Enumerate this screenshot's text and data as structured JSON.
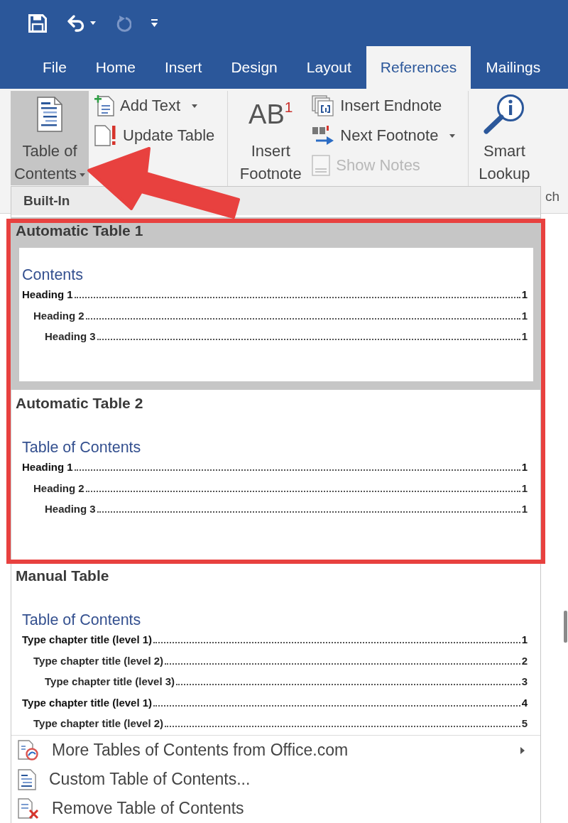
{
  "quick_access": [
    {
      "kind": "save",
      "disabled": false,
      "dropdown": false
    },
    {
      "kind": "undo",
      "disabled": false,
      "dropdown": true
    },
    {
      "kind": "redo",
      "disabled": true,
      "dropdown": false
    },
    {
      "kind": "customize",
      "disabled": false,
      "dropdown": false
    }
  ],
  "tabs": [
    {
      "label": "File",
      "selected": false
    },
    {
      "label": "Home",
      "selected": false
    },
    {
      "label": "Insert",
      "selected": false
    },
    {
      "label": "Design",
      "selected": false
    },
    {
      "label": "Layout",
      "selected": false
    },
    {
      "label": "References",
      "selected": true
    },
    {
      "label": "Mailings",
      "selected": false
    }
  ],
  "ribbon": {
    "groups": [
      {
        "kind": "toc",
        "large_button": {
          "label": "Table of Contents",
          "dropdown": true,
          "expanded": true
        },
        "small_buttons": [
          {
            "kind": "add-text",
            "label": "Add Text",
            "dropdown": true,
            "disabled": false
          },
          {
            "kind": "update-table",
            "label": "Update Table",
            "dropdown": false,
            "disabled": false
          }
        ]
      },
      {
        "kind": "footnotes",
        "large_button": {
          "glyph": "AB$^{1}$",
          "label": "Insert Footnote",
          "dropdown": false,
          "expanded": false
        },
        "small_buttons": [
          {
            "kind": "insert-endnote",
            "label": "Insert Endnote",
            "dropdown": false,
            "disabled": false
          },
          {
            "kind": "next-footnote",
            "label": "Next Footnote",
            "dropdown": true,
            "disabled": false
          },
          {
            "kind": "show-notes",
            "label": "Show Notes",
            "dropdown": false,
            "disabled": true
          }
        ]
      },
      {
        "kind": "research",
        "large_button": {
          "label": "Smart Lookup",
          "dropdown": false,
          "expanded": false
        },
        "group_label": "ch"
      }
    ]
  },
  "toc_menu": {
    "header": "Built-In",
    "gallery": [
      {
        "title": "Automatic Table 1",
        "selected": true,
        "framed": true,
        "preview": {
          "heading": "Contents",
          "entries": [
            {
              "text": "Heading 1",
              "page": "1",
              "children": [
                {
                  "text": "Heading 2",
                  "page": "1",
                  "children": [
                    {
                      "text": "Heading 3",
                      "page": "1"
                    }
                  ]
                }
              ]
            }
          ]
        }
      },
      {
        "title": "Automatic Table 2",
        "selected": false,
        "framed": true,
        "preview": {
          "heading": "Table of Contents",
          "entries": [
            {
              "text": "Heading 1",
              "page": "1",
              "children": [
                {
                  "text": "Heading 2",
                  "page": "1",
                  "children": [
                    {
                      "text": "Heading 3",
                      "page": "1"
                    }
                  ]
                }
              ]
            }
          ]
        }
      },
      {
        "title": "Manual Table",
        "selected": false,
        "framed": false,
        "preview": {
          "heading": "Table of Contents",
          "entries": [
            {
              "text": "Type chapter title (level 1)",
              "page": "1",
              "children": [
                {
                  "text": "Type chapter title (level 2)",
                  "page": "2",
                  "children": [
                    {
                      "text": "Type chapter title (level 3)",
                      "page": "3"
                    }
                  ]
                }
              ]
            },
            {
              "text": "Type chapter title (level 1)",
              "page": "4",
              "children": [
                {
                  "text": "Type chapter title (level 2)",
                  "page": "5"
                }
              ]
            }
          ]
        }
      }
    ],
    "commands": [
      {
        "kind": "more",
        "label": "More Tables of Contents from Office.com",
        "submenu": true
      },
      {
        "kind": "custom",
        "label": "Custom Table of Contents...",
        "submenu": false
      },
      {
        "kind": "remove",
        "label": "Remove Table of Contents",
        "submenu": false
      }
    ]
  },
  "annotations": [
    {
      "kind": "arrow"
    }
  ]
}
